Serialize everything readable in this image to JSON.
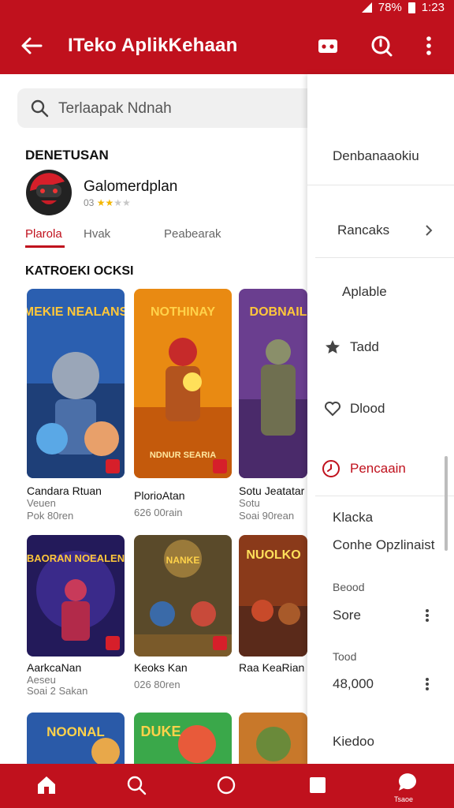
{
  "status_bar": {
    "battery": "78%",
    "time": "1:23"
  },
  "app_bar": {
    "title": "ITeko AplikKehaan"
  },
  "search": {
    "placeholder": "Terlaapak Ndnah"
  },
  "featured": {
    "section_title": "DENETUSAN",
    "app_name": "Galomerdplan",
    "rating_label": "03",
    "rating": 2.5,
    "tabs": [
      "Plarola",
      "Hvak",
      "Peabearak"
    ]
  },
  "catalog": {
    "section_title": "KATROEKI OCKSI",
    "cards": [
      {
        "art_title": "MEKIE NEALANS",
        "title": "Candara Rtuan",
        "meta": [
          "Veuen",
          "Pok 80ren"
        ]
      },
      {
        "art_title": "NOTHINAY",
        "art_subtitle": "NDNUR SEARIA",
        "title": "PlorioAtan",
        "meta": [
          "626 00rain"
        ]
      },
      {
        "art_title": "DOBNAIL",
        "title": "Sotu Jeatatar",
        "meta": [
          "Sotu",
          "Soai 90rean"
        ]
      },
      {
        "art_title": "BAORAN NOEALEN",
        "title": "AarkcaNan",
        "meta": [
          "Aeseu",
          "Soai 2 Sakan"
        ]
      },
      {
        "art_title": "NANKE",
        "title": "Keoks Kan",
        "meta": [
          "026 80ren"
        ]
      },
      {
        "art_title": "NUOLKO",
        "title": "Raa KeaRian",
        "meta": []
      },
      {
        "art_title": "NOONAL",
        "title": "",
        "meta": []
      },
      {
        "art_title": "DUKE",
        "title": "",
        "meta": []
      },
      {
        "art_title": "",
        "title": "",
        "meta": []
      }
    ]
  },
  "drawer": {
    "header": "Denbanaaokiu",
    "rancaks": "Rancaks",
    "aplable": "Aplable",
    "tadd": "Tadd",
    "dlood": "Dlood",
    "pencaain": "Pencaain",
    "klacka": "Klacka",
    "conhe": "Conhe Opzlinaist",
    "beood_label": "Beood",
    "beood_value": "Sore",
    "tood_label": "Tood",
    "tood_value": "48,000",
    "kiedoo": "Kiedoo"
  },
  "bottom_nav": {
    "label": "Tsaoe"
  },
  "colors": {
    "brand": "#c0111d",
    "star": "#f3b600"
  }
}
